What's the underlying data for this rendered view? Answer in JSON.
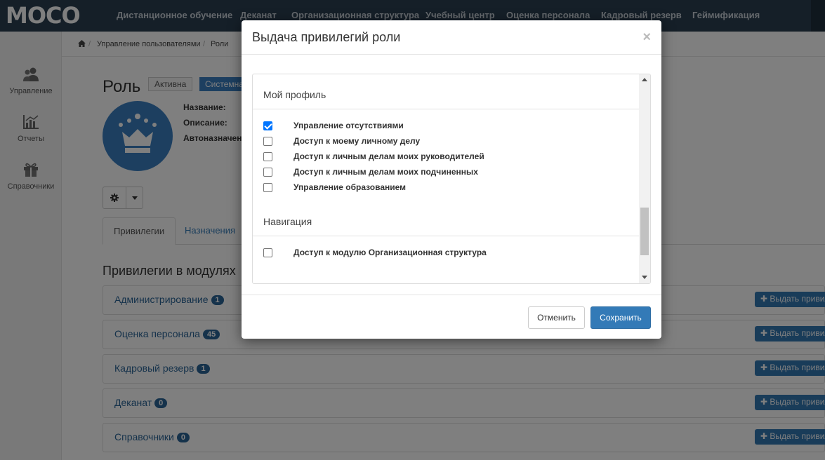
{
  "nav": {
    "logo": "MOCO",
    "items": [
      "Дистанционное обучение",
      "Деканат",
      "Организационная структура",
      "Учебный центр",
      "Оценка персонала",
      "Кадровый резерв",
      "Геймификация"
    ]
  },
  "sidebar": {
    "items": [
      {
        "label": "Управление",
        "icon": "users-icon"
      },
      {
        "label": "Отчеты",
        "icon": "chart-icon"
      },
      {
        "label": "Справочники",
        "icon": "gift-icon"
      }
    ]
  },
  "breadcrumb": {
    "home_icon": "home-icon",
    "items": [
      "Управление пользователями",
      "Роли"
    ]
  },
  "role": {
    "title": "Роль",
    "status": "Активна",
    "type": "Системная",
    "fields": [
      "Название:",
      "Описание:",
      "Автоназначение:"
    ]
  },
  "tabs": [
    "Привилегии",
    "Назначения"
  ],
  "modules": {
    "title": "Привилегии в модулях",
    "grant_label": "Выдать привилегии",
    "items": [
      {
        "name": "Администрирование",
        "count": "1"
      },
      {
        "name": "Оценка персонала",
        "count": "45"
      },
      {
        "name": "Кадровый резерв",
        "count": "1"
      },
      {
        "name": "Деканат",
        "count": "0"
      },
      {
        "name": "Справочники",
        "count": "0"
      }
    ]
  },
  "modal": {
    "title": "Выдача привилегий роли",
    "close": "×",
    "groups": [
      {
        "title": "Мой профиль",
        "permissions": [
          {
            "label": "Управление отсутствиями",
            "checked": true
          },
          {
            "label": "Доступ к моему личному делу",
            "checked": false
          },
          {
            "label": "Доступ к личным делам моих руководителей",
            "checked": false
          },
          {
            "label": "Доступ к личным делам моих подчиненных",
            "checked": false
          },
          {
            "label": "Управление образованием",
            "checked": false
          }
        ]
      },
      {
        "title": "Навигация",
        "permissions": [
          {
            "label": "Доступ к модулю Организационная структура",
            "checked": false
          }
        ]
      }
    ],
    "cancel": "Отменить",
    "save": "Сохранить"
  },
  "colors": {
    "nav_bg": "#2b3e50",
    "primary": "#337ab7",
    "checkbox": "#0075ff"
  }
}
